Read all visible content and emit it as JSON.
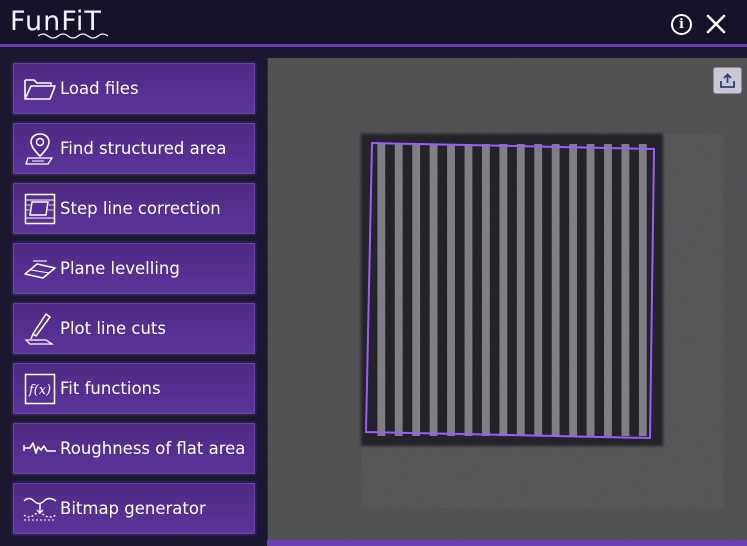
{
  "app": {
    "title": "FunFiT",
    "accent_color": "#6a3fb5",
    "button_color": "#54308c"
  },
  "titlebar": {
    "info_icon": "info-icon",
    "close_icon": "close-icon",
    "info_glyph": "i"
  },
  "sidebar": {
    "items": [
      {
        "label": "Load files",
        "icon": "folder-icon"
      },
      {
        "label": "Find structured area",
        "icon": "map-pin-icon"
      },
      {
        "label": "Step line correction",
        "icon": "step-correction-icon"
      },
      {
        "label": "Plane levelling",
        "icon": "plane-icon"
      },
      {
        "label": "Plot line cuts",
        "icon": "knife-cut-icon"
      },
      {
        "label": "Fit functions",
        "icon": "function-icon"
      },
      {
        "label": "Roughness of flat area",
        "icon": "roughness-icon"
      },
      {
        "label": "Bitmap generator",
        "icon": "bitmap-icon"
      }
    ]
  },
  "viewer": {
    "export_icon": "export-icon",
    "selection_color": "#9a5cff",
    "stripe_count": 16
  }
}
